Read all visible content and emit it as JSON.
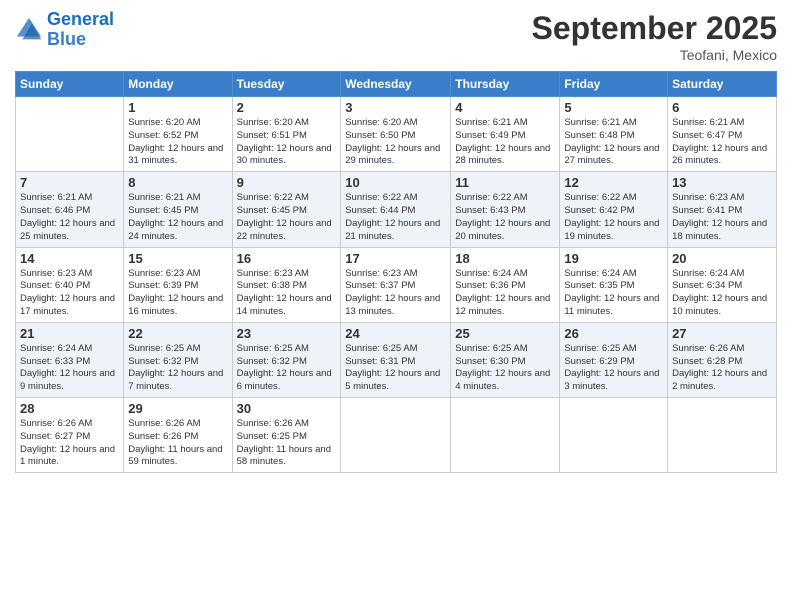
{
  "header": {
    "logo_line1": "General",
    "logo_line2": "Blue",
    "month_title": "September 2025",
    "location": "Teofani, Mexico"
  },
  "weekdays": [
    "Sunday",
    "Monday",
    "Tuesday",
    "Wednesday",
    "Thursday",
    "Friday",
    "Saturday"
  ],
  "weeks": [
    [
      {
        "day": "",
        "sunrise": "",
        "sunset": "",
        "daylight": ""
      },
      {
        "day": "1",
        "sunrise": "Sunrise: 6:20 AM",
        "sunset": "Sunset: 6:52 PM",
        "daylight": "Daylight: 12 hours and 31 minutes."
      },
      {
        "day": "2",
        "sunrise": "Sunrise: 6:20 AM",
        "sunset": "Sunset: 6:51 PM",
        "daylight": "Daylight: 12 hours and 30 minutes."
      },
      {
        "day": "3",
        "sunrise": "Sunrise: 6:20 AM",
        "sunset": "Sunset: 6:50 PM",
        "daylight": "Daylight: 12 hours and 29 minutes."
      },
      {
        "day": "4",
        "sunrise": "Sunrise: 6:21 AM",
        "sunset": "Sunset: 6:49 PM",
        "daylight": "Daylight: 12 hours and 28 minutes."
      },
      {
        "day": "5",
        "sunrise": "Sunrise: 6:21 AM",
        "sunset": "Sunset: 6:48 PM",
        "daylight": "Daylight: 12 hours and 27 minutes."
      },
      {
        "day": "6",
        "sunrise": "Sunrise: 6:21 AM",
        "sunset": "Sunset: 6:47 PM",
        "daylight": "Daylight: 12 hours and 26 minutes."
      }
    ],
    [
      {
        "day": "7",
        "sunrise": "Sunrise: 6:21 AM",
        "sunset": "Sunset: 6:46 PM",
        "daylight": "Daylight: 12 hours and 25 minutes."
      },
      {
        "day": "8",
        "sunrise": "Sunrise: 6:21 AM",
        "sunset": "Sunset: 6:45 PM",
        "daylight": "Daylight: 12 hours and 24 minutes."
      },
      {
        "day": "9",
        "sunrise": "Sunrise: 6:22 AM",
        "sunset": "Sunset: 6:45 PM",
        "daylight": "Daylight: 12 hours and 22 minutes."
      },
      {
        "day": "10",
        "sunrise": "Sunrise: 6:22 AM",
        "sunset": "Sunset: 6:44 PM",
        "daylight": "Daylight: 12 hours and 21 minutes."
      },
      {
        "day": "11",
        "sunrise": "Sunrise: 6:22 AM",
        "sunset": "Sunset: 6:43 PM",
        "daylight": "Daylight: 12 hours and 20 minutes."
      },
      {
        "day": "12",
        "sunrise": "Sunrise: 6:22 AM",
        "sunset": "Sunset: 6:42 PM",
        "daylight": "Daylight: 12 hours and 19 minutes."
      },
      {
        "day": "13",
        "sunrise": "Sunrise: 6:23 AM",
        "sunset": "Sunset: 6:41 PM",
        "daylight": "Daylight: 12 hours and 18 minutes."
      }
    ],
    [
      {
        "day": "14",
        "sunrise": "Sunrise: 6:23 AM",
        "sunset": "Sunset: 6:40 PM",
        "daylight": "Daylight: 12 hours and 17 minutes."
      },
      {
        "day": "15",
        "sunrise": "Sunrise: 6:23 AM",
        "sunset": "Sunset: 6:39 PM",
        "daylight": "Daylight: 12 hours and 16 minutes."
      },
      {
        "day": "16",
        "sunrise": "Sunrise: 6:23 AM",
        "sunset": "Sunset: 6:38 PM",
        "daylight": "Daylight: 12 hours and 14 minutes."
      },
      {
        "day": "17",
        "sunrise": "Sunrise: 6:23 AM",
        "sunset": "Sunset: 6:37 PM",
        "daylight": "Daylight: 12 hours and 13 minutes."
      },
      {
        "day": "18",
        "sunrise": "Sunrise: 6:24 AM",
        "sunset": "Sunset: 6:36 PM",
        "daylight": "Daylight: 12 hours and 12 minutes."
      },
      {
        "day": "19",
        "sunrise": "Sunrise: 6:24 AM",
        "sunset": "Sunset: 6:35 PM",
        "daylight": "Daylight: 12 hours and 11 minutes."
      },
      {
        "day": "20",
        "sunrise": "Sunrise: 6:24 AM",
        "sunset": "Sunset: 6:34 PM",
        "daylight": "Daylight: 12 hours and 10 minutes."
      }
    ],
    [
      {
        "day": "21",
        "sunrise": "Sunrise: 6:24 AM",
        "sunset": "Sunset: 6:33 PM",
        "daylight": "Daylight: 12 hours and 9 minutes."
      },
      {
        "day": "22",
        "sunrise": "Sunrise: 6:25 AM",
        "sunset": "Sunset: 6:32 PM",
        "daylight": "Daylight: 12 hours and 7 minutes."
      },
      {
        "day": "23",
        "sunrise": "Sunrise: 6:25 AM",
        "sunset": "Sunset: 6:32 PM",
        "daylight": "Daylight: 12 hours and 6 minutes."
      },
      {
        "day": "24",
        "sunrise": "Sunrise: 6:25 AM",
        "sunset": "Sunset: 6:31 PM",
        "daylight": "Daylight: 12 hours and 5 minutes."
      },
      {
        "day": "25",
        "sunrise": "Sunrise: 6:25 AM",
        "sunset": "Sunset: 6:30 PM",
        "daylight": "Daylight: 12 hours and 4 minutes."
      },
      {
        "day": "26",
        "sunrise": "Sunrise: 6:25 AM",
        "sunset": "Sunset: 6:29 PM",
        "daylight": "Daylight: 12 hours and 3 minutes."
      },
      {
        "day": "27",
        "sunrise": "Sunrise: 6:26 AM",
        "sunset": "Sunset: 6:28 PM",
        "daylight": "Daylight: 12 hours and 2 minutes."
      }
    ],
    [
      {
        "day": "28",
        "sunrise": "Sunrise: 6:26 AM",
        "sunset": "Sunset: 6:27 PM",
        "daylight": "Daylight: 12 hours and 1 minute."
      },
      {
        "day": "29",
        "sunrise": "Sunrise: 6:26 AM",
        "sunset": "Sunset: 6:26 PM",
        "daylight": "Daylight: 11 hours and 59 minutes."
      },
      {
        "day": "30",
        "sunrise": "Sunrise: 6:26 AM",
        "sunset": "Sunset: 6:25 PM",
        "daylight": "Daylight: 11 hours and 58 minutes."
      },
      {
        "day": "",
        "sunrise": "",
        "sunset": "",
        "daylight": ""
      },
      {
        "day": "",
        "sunrise": "",
        "sunset": "",
        "daylight": ""
      },
      {
        "day": "",
        "sunrise": "",
        "sunset": "",
        "daylight": ""
      },
      {
        "day": "",
        "sunrise": "",
        "sunset": "",
        "daylight": ""
      }
    ]
  ]
}
